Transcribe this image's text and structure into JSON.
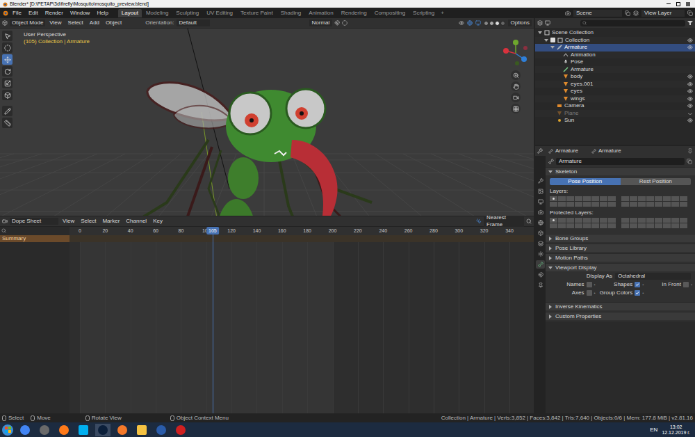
{
  "window": {
    "title": "Blender* [D:\\PETAP\\3d\\firefly\\Mosquito\\mosquito_preview.blend]"
  },
  "menu": [
    "File",
    "Edit",
    "Render",
    "Window",
    "Help"
  ],
  "workspaces": [
    {
      "label": "Layout",
      "selected": true
    },
    {
      "label": "Modeling",
      "selected": false
    },
    {
      "label": "Sculpting",
      "selected": false
    },
    {
      "label": "UV Editing",
      "selected": false
    },
    {
      "label": "Texture Paint",
      "selected": false
    },
    {
      "label": "Shading",
      "selected": false
    },
    {
      "label": "Animation",
      "selected": false
    },
    {
      "label": "Rendering",
      "selected": false
    },
    {
      "label": "Compositing",
      "selected": false
    },
    {
      "label": "Scripting",
      "selected": false
    }
  ],
  "add_workspace": "+",
  "scene": "Scene",
  "view_layer": "View Layer",
  "viewport": {
    "mode": "Object Mode",
    "menu": [
      "View",
      "Select",
      "Add",
      "Object"
    ],
    "orientation_label": "Orientation:",
    "orientation": "Default",
    "transform": "Normal",
    "options": "Options",
    "perspective": "User Perspective",
    "context": "(105) Collection | Armature"
  },
  "outliner": {
    "items": [
      {
        "label": "Scene Collection",
        "kind": "collection",
        "depth": 0,
        "expanded": true,
        "selected": false,
        "greyed": false,
        "visible": null
      },
      {
        "label": "Collection",
        "kind": "collection",
        "depth": 1,
        "expanded": true,
        "selected": false,
        "greyed": false,
        "visible": true
      },
      {
        "label": "Armature",
        "kind": "armature",
        "depth": 2,
        "expanded": true,
        "selected": true,
        "greyed": false,
        "visible": true
      },
      {
        "label": "Animation",
        "kind": "action",
        "depth": 3,
        "expanded": false,
        "selected": false,
        "greyed": false,
        "visible": null
      },
      {
        "label": "Pose",
        "kind": "pose",
        "depth": 3,
        "expanded": false,
        "selected": false,
        "greyed": false,
        "visible": null
      },
      {
        "label": "Armature",
        "kind": "bone",
        "depth": 3,
        "expanded": false,
        "selected": false,
        "greyed": false,
        "visible": null
      },
      {
        "label": "body",
        "kind": "mesh",
        "depth": 3,
        "expanded": false,
        "selected": false,
        "greyed": false,
        "visible": true
      },
      {
        "label": "eyes.001",
        "kind": "mesh",
        "depth": 3,
        "expanded": false,
        "selected": false,
        "greyed": false,
        "visible": true
      },
      {
        "label": "eyes",
        "kind": "mesh",
        "depth": 3,
        "expanded": false,
        "selected": false,
        "greyed": false,
        "visible": true
      },
      {
        "label": "wings",
        "kind": "mesh",
        "depth": 3,
        "expanded": false,
        "selected": false,
        "greyed": false,
        "visible": true
      },
      {
        "label": "Camera",
        "kind": "camera",
        "depth": 2,
        "expanded": false,
        "selected": false,
        "greyed": false,
        "visible": true
      },
      {
        "label": "Plane",
        "kind": "mesh",
        "depth": 2,
        "expanded": false,
        "selected": false,
        "greyed": true,
        "visible": false
      },
      {
        "label": "Sun",
        "kind": "light",
        "depth": 2,
        "expanded": false,
        "selected": false,
        "greyed": false,
        "visible": true
      }
    ]
  },
  "properties": {
    "breadcrumb": [
      "Armature",
      "Armature"
    ],
    "name": "Armature",
    "skeleton": {
      "title": "Skeleton",
      "expanded": true
    },
    "positions": [
      {
        "label": "Pose Position",
        "selected": true
      },
      {
        "label": "Rest Position",
        "selected": false
      }
    ],
    "layers": {
      "label": "Layers:",
      "marks": [
        true,
        false,
        false,
        false,
        false,
        false,
        false,
        false,
        false,
        false,
        false,
        false,
        false,
        false,
        false,
        false,
        false,
        false,
        false,
        false,
        false,
        false,
        false,
        false,
        false,
        false,
        false,
        false,
        false,
        false,
        false,
        false
      ]
    },
    "protected_layers": {
      "label": "Protected Layers:",
      "marks": [
        true,
        false,
        false,
        false,
        false,
        false,
        false,
        false,
        false,
        false,
        false,
        false,
        false,
        false,
        false,
        false,
        false,
        false,
        false,
        false,
        false,
        false,
        false,
        false,
        false,
        false,
        false,
        false,
        false,
        false,
        false,
        false
      ]
    },
    "sections_before": [
      {
        "title": "Bone Groups",
        "expanded": false
      },
      {
        "title": "Pose Library",
        "expanded": false
      },
      {
        "title": "Motion Paths",
        "expanded": false
      }
    ],
    "viewport_display": {
      "title": "Viewport Display",
      "expanded": true,
      "display_as_label": "Display As",
      "display_as": "Octahedral",
      "rows": [
        [
          {
            "label": "Names",
            "checked": false
          },
          {
            "label": "Shapes",
            "checked": true
          },
          {
            "label": "In Front",
            "checked": false
          }
        ],
        [
          {
            "label": "Axes",
            "checked": false
          },
          {
            "label": "Group Colors",
            "checked": true
          }
        ]
      ]
    },
    "sections_after": [
      {
        "title": "Inverse Kinematics",
        "expanded": false
      },
      {
        "title": "Custom Properties",
        "expanded": false
      }
    ]
  },
  "timeline": {
    "editor": "Dope Sheet",
    "menu": [
      "View",
      "Select",
      "Marker",
      "Channel",
      "Key"
    ],
    "snap": "Nearest Frame",
    "ticks": [
      "0",
      "20",
      "40",
      "60",
      "80",
      "100",
      "120",
      "140",
      "160",
      "180",
      "200",
      "220",
      "240",
      "260",
      "280",
      "300",
      "320",
      "340"
    ],
    "current": "105",
    "range_end": 200,
    "channel": "Summary"
  },
  "status_bar": {
    "hints": [
      "Select",
      "Move",
      "Rotate View",
      "Object Context Menu"
    ],
    "stats": "Collection | Armature | Verts:3,852 | Faces:3,842 | Tris:7,640 | Objects:0/6 | Mem: 177.8 MiB | v2.81.16"
  },
  "taskbar": {
    "language": "EN",
    "time": "13:02",
    "date": "12.12.2019 г."
  }
}
